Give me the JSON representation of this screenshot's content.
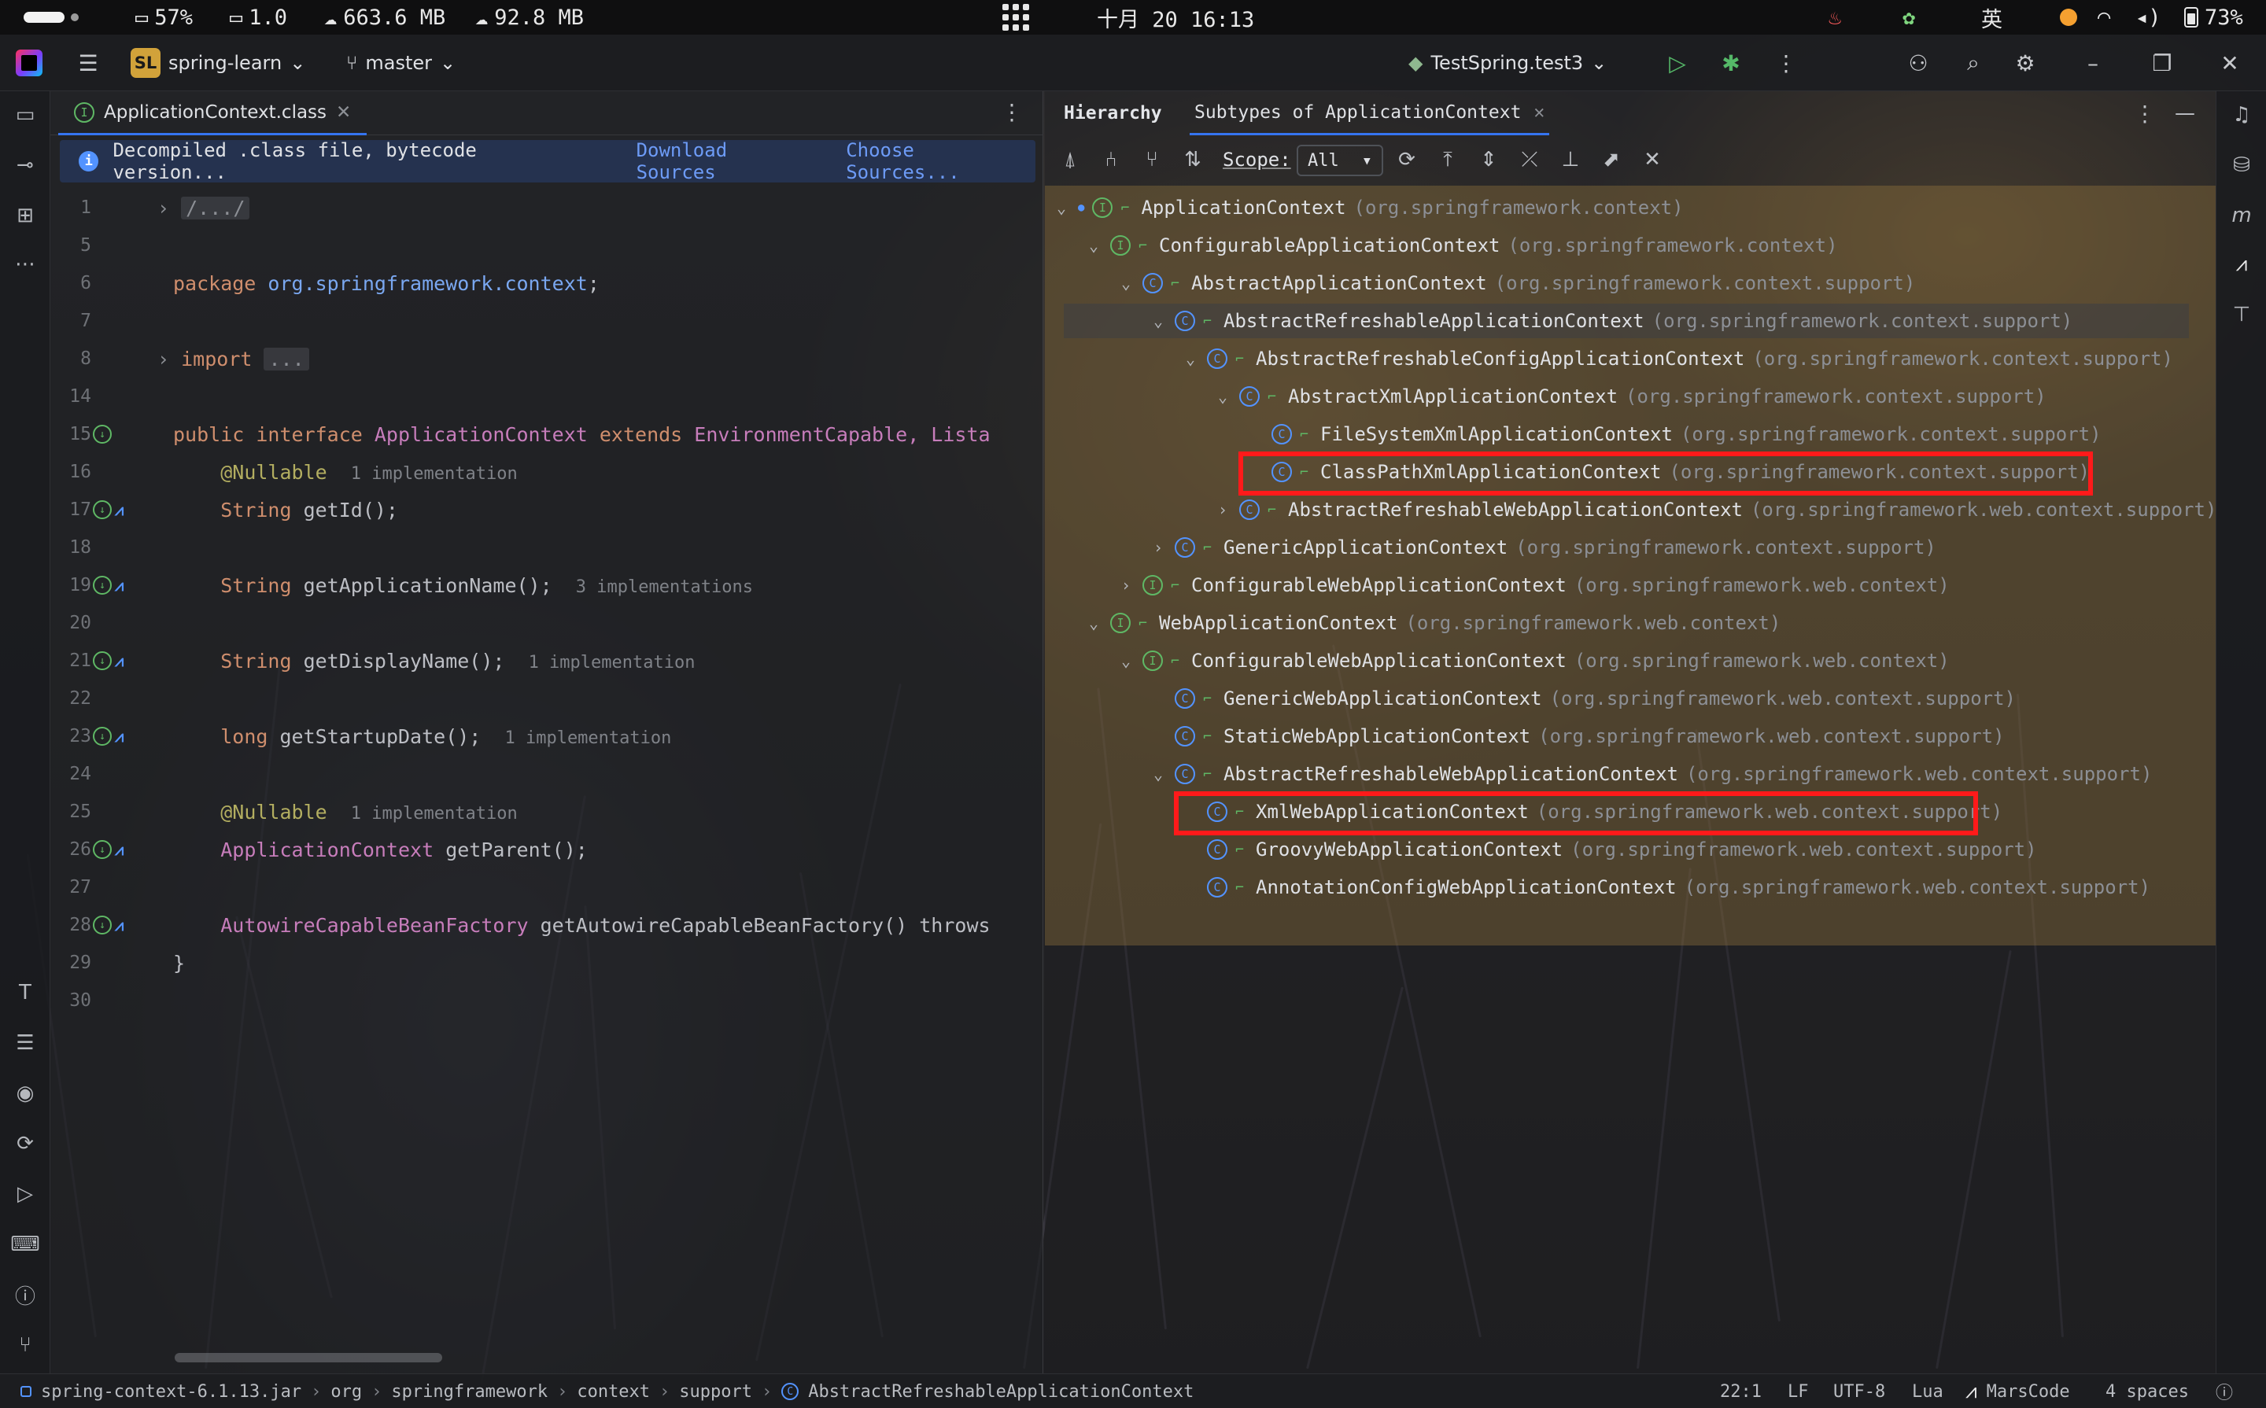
{
  "system_bar": {
    "battery_left": "57%",
    "display_load": "1.0",
    "download": "663.6 MB",
    "upload": "92.8 MB",
    "clock": "十月 20 16:13",
    "input_method": "英",
    "battery_right": "73%"
  },
  "toolbar": {
    "project_badge": "SL",
    "project_name": "spring-learn",
    "branch": "master",
    "run_config": "TestSpring.test3"
  },
  "editor": {
    "tab_label": "ApplicationContext.class",
    "notice_text": "Decompiled .class file, bytecode version...",
    "download_sources": "Download Sources",
    "choose_sources": "Choose Sources...",
    "lines": [
      {
        "no": "1",
        "fold": "›",
        "text": "/.../"
      },
      {
        "no": "5",
        "text": ""
      },
      {
        "no": "6",
        "kw": "package ",
        "pkg": "org.springframework.context",
        "rest": ";"
      },
      {
        "no": "7",
        "text": ""
      },
      {
        "no": "8",
        "fold": "›",
        "kw": "import ",
        "box": "..."
      },
      {
        "no": "14",
        "text": ""
      },
      {
        "no": "15",
        "kw": "public interface ",
        "typ": "ApplicationContext",
        "kw2": " extends ",
        "typ2": "EnvironmentCapable, Lista"
      },
      {
        "no": "16",
        "ann": "@Nullable",
        "hint": "1 implementation"
      },
      {
        "no": "17",
        "kw": "String ",
        "rest": "getId();"
      },
      {
        "no": "18",
        "text": ""
      },
      {
        "no": "19",
        "kw": "String ",
        "rest": "getApplicationName();",
        "hint": "3 implementations"
      },
      {
        "no": "20",
        "text": ""
      },
      {
        "no": "21",
        "kw": "String ",
        "rest": "getDisplayName();",
        "hint": "1 implementation"
      },
      {
        "no": "22",
        "text": ""
      },
      {
        "no": "23",
        "kw": "long ",
        "rest": "getStartupDate();",
        "hint": "1 implementation"
      },
      {
        "no": "24",
        "text": ""
      },
      {
        "no": "25",
        "ann": "@Nullable",
        "hint": "1 implementation"
      },
      {
        "no": "26",
        "typ": "ApplicationContext",
        "rest": " getParent();"
      },
      {
        "no": "27",
        "text": ""
      },
      {
        "no": "28",
        "typ": "AutowireCapableBeanFactory",
        "rest": " getAutowireCapableBeanFactory() throws"
      },
      {
        "no": "29",
        "text": "}"
      },
      {
        "no": "30",
        "text": ""
      }
    ]
  },
  "hierarchy": {
    "title": "Hierarchy",
    "tab_label": "Subtypes of ApplicationContext",
    "scope_label": "Scope:",
    "scope_value": "All",
    "nodes": [
      {
        "name": "ApplicationContext",
        "pkg": "(org.springframework.context)",
        "kind": "I",
        "chev": "⌄"
      },
      {
        "name": "ConfigurableApplicationContext",
        "pkg": "(org.springframework.context)",
        "kind": "I",
        "chev": "⌄"
      },
      {
        "name": "AbstractApplicationContext",
        "pkg": "(org.springframework.context.support)",
        "kind": "C",
        "chev": "⌄"
      },
      {
        "name": "AbstractRefreshableApplicationContext",
        "pkg": "(org.springframework.context.support)",
        "kind": "C",
        "chev": "⌄"
      },
      {
        "name": "AbstractRefreshableConfigApplicationContext",
        "pkg": "(org.springframework.context.support)",
        "kind": "C",
        "chev": "⌄"
      },
      {
        "name": "AbstractXmlApplicationContext",
        "pkg": "(org.springframework.context.support)",
        "kind": "C",
        "chev": "⌄"
      },
      {
        "name": "FileSystemXmlApplicationContext",
        "pkg": "(org.springframework.context.support)",
        "kind": "C",
        "chev": ""
      },
      {
        "name": "ClassPathXmlApplicationContext",
        "pkg": "(org.springframework.context.support)",
        "kind": "C",
        "chev": ""
      },
      {
        "name": "AbstractRefreshableWebApplicationContext",
        "pkg": "(org.springframework.web.context.support)",
        "kind": "C",
        "chev": "›"
      },
      {
        "name": "GenericApplicationContext",
        "pkg": "(org.springframework.context.support)",
        "kind": "C",
        "chev": "›"
      },
      {
        "name": "ConfigurableWebApplicationContext",
        "pkg": "(org.springframework.web.context)",
        "kind": "I",
        "chev": "›"
      },
      {
        "name": "WebApplicationContext",
        "pkg": "(org.springframework.web.context)",
        "kind": "I",
        "chev": "⌄"
      },
      {
        "name": "ConfigurableWebApplicationContext",
        "pkg": "(org.springframework.web.context)",
        "kind": "I",
        "chev": "⌄"
      },
      {
        "name": "GenericWebApplicationContext",
        "pkg": "(org.springframework.web.context.support)",
        "kind": "C",
        "chev": ""
      },
      {
        "name": "StaticWebApplicationContext",
        "pkg": "(org.springframework.web.context.support)",
        "kind": "C",
        "chev": ""
      },
      {
        "name": "AbstractRefreshableWebApplicationContext",
        "pkg": "(org.springframework.web.context.support)",
        "kind": "C",
        "chev": "⌄"
      },
      {
        "name": "XmlWebApplicationContext",
        "pkg": "(org.springframework.web.context.support)",
        "kind": "C",
        "chev": ""
      },
      {
        "name": "GroovyWebApplicationContext",
        "pkg": "(org.springframework.web.context.support)",
        "kind": "C",
        "chev": ""
      },
      {
        "name": "AnnotationConfigWebApplicationContext",
        "pkg": "(org.springframework.web.context.support)",
        "kind": "C",
        "chev": ""
      }
    ]
  },
  "status": {
    "breadcrumbs": [
      "spring-context-6.1.13.jar",
      "org",
      "springframework",
      "context",
      "support",
      "AbstractRefreshableApplicationContext"
    ],
    "position": "22:1",
    "line_sep": "LF",
    "encoding": "UTF-8",
    "language": "Lua",
    "plugin": "MarsCode",
    "indent": "4 spaces"
  },
  "colors": {
    "accent": "#3574f0",
    "highlight_box": "#ff1a1a",
    "interface_icon": "#5fb865",
    "class_icon": "#5393ff"
  }
}
